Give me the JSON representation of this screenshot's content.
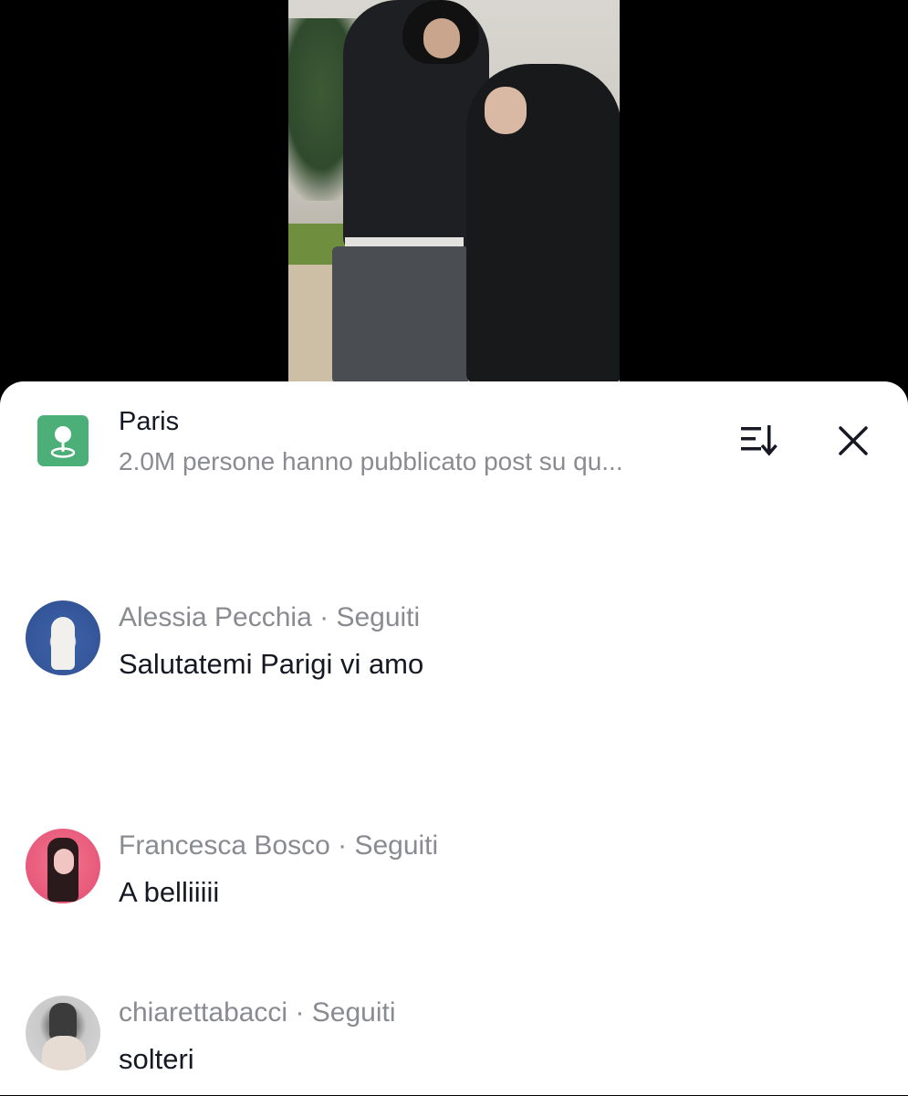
{
  "header": {
    "title": "Paris",
    "subtitle": "2.0M persone hanno pubblicato post su qu...",
    "location_icon": "location-pin-icon",
    "sort_icon": "sort-icon",
    "close_icon": "close-icon",
    "accent_color": "#4caf77"
  },
  "comments": [
    {
      "author": "Alessia Pecchia",
      "relation": "Seguiti",
      "text": "Salutatemi Parigi vi amo"
    },
    {
      "author": "Francesca Bosco",
      "relation": "Seguiti",
      "text": "A belliiiii"
    },
    {
      "author": "chiarettabacci",
      "relation": "Seguiti",
      "text": "solteri"
    }
  ],
  "separator": " · "
}
